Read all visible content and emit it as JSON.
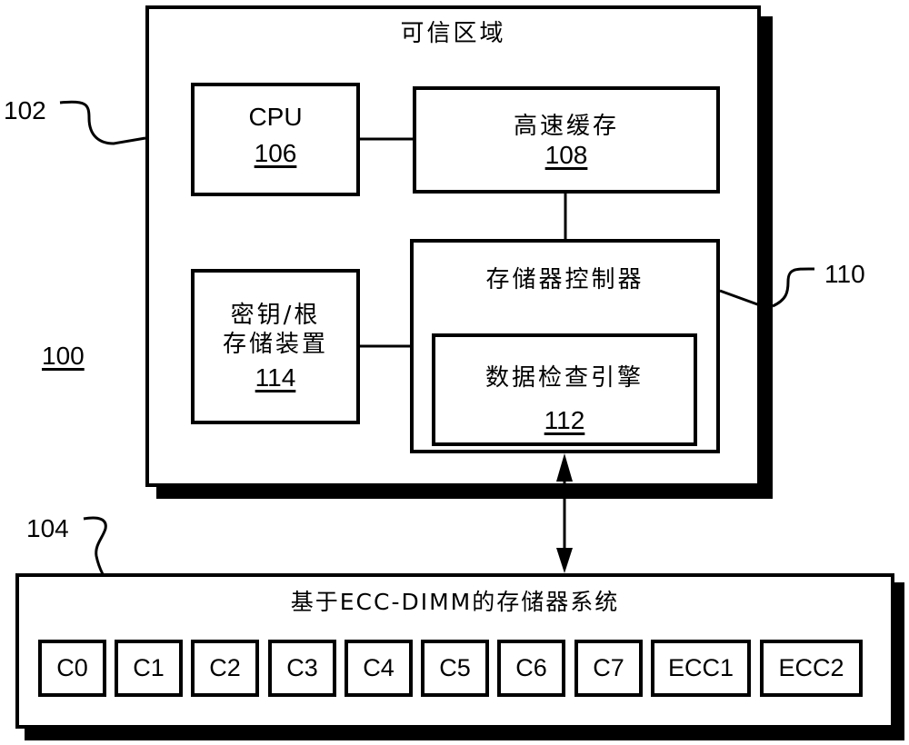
{
  "trusted_region": {
    "title": "可信区域",
    "ref": "102"
  },
  "system_ref": "100",
  "cpu": {
    "label": "CPU",
    "ref": "106"
  },
  "cache": {
    "label": "高速缓存",
    "ref": "108"
  },
  "memory_controller": {
    "label": "存储器控制器",
    "ref": "110"
  },
  "data_check_engine": {
    "label": "数据检查引擎",
    "ref": "112"
  },
  "key_root_storage": {
    "label_line1": "密钥/根",
    "label_line2": "存储装置",
    "ref": "114"
  },
  "memory_system": {
    "title": "基于ECC-DIMM的存储器系统",
    "ref": "104",
    "chips": [
      "C0",
      "C1",
      "C2",
      "C3",
      "C4",
      "C5",
      "C6",
      "C7",
      "ECC1",
      "ECC2"
    ]
  }
}
